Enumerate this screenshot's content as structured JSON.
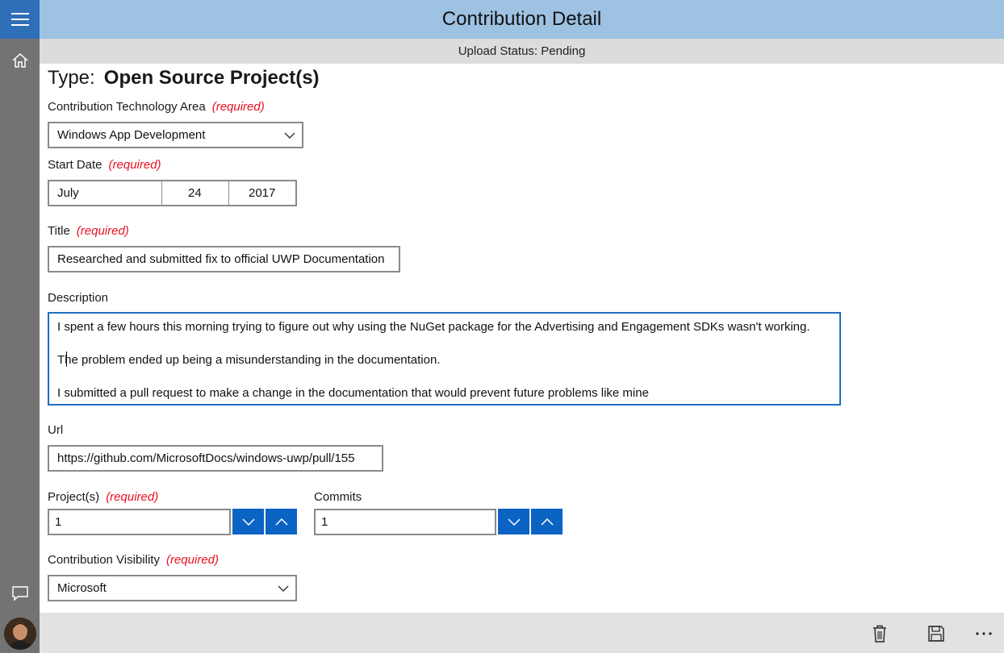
{
  "header": {
    "title": "Contribution Detail"
  },
  "status": {
    "text": "Upload Status: Pending"
  },
  "form": {
    "type_label": "Type:",
    "type_value": "Open Source Project(s)",
    "required_text": "(required)",
    "tech_area": {
      "label": "Contribution Technology Area",
      "value": "Windows App Development"
    },
    "start_date": {
      "label": "Start Date",
      "month": "July",
      "day": "24",
      "year": "2017"
    },
    "title_field": {
      "label": "Title",
      "value": "Researched and submitted fix to official UWP Documentation"
    },
    "description": {
      "label": "Description",
      "lines": [
        "I spent a few hours this morning trying to figure out why using the NuGet package for the Advertising and Engagement SDKs wasn't working.",
        "The problem ended up being a misunderstanding in the documentation.",
        "I submitted a pull request to make a change in the documentation that would prevent future problems like mine"
      ]
    },
    "url": {
      "label": "Url",
      "value": "https://github.com/MicrosoftDocs/windows-uwp/pull/155"
    },
    "projects": {
      "label": "Project(s)",
      "value": "1"
    },
    "commits": {
      "label": "Commits",
      "value": "1"
    },
    "visibility": {
      "label": "Contribution Visibility",
      "value": "Microsoft"
    }
  },
  "icons": {
    "rail": [
      "hamburger-menu-icon",
      "home-icon",
      "feedback-icon"
    ],
    "commands": [
      "delete-icon",
      "save-icon",
      "more-icon"
    ]
  },
  "colors": {
    "header_bg": "#9dc2e2",
    "rail_bg": "#737373",
    "accent": "#0b63c4",
    "required": "#e81123",
    "status_bg": "#dcdcdc",
    "cmdbar_bg": "#e2e2e2"
  }
}
